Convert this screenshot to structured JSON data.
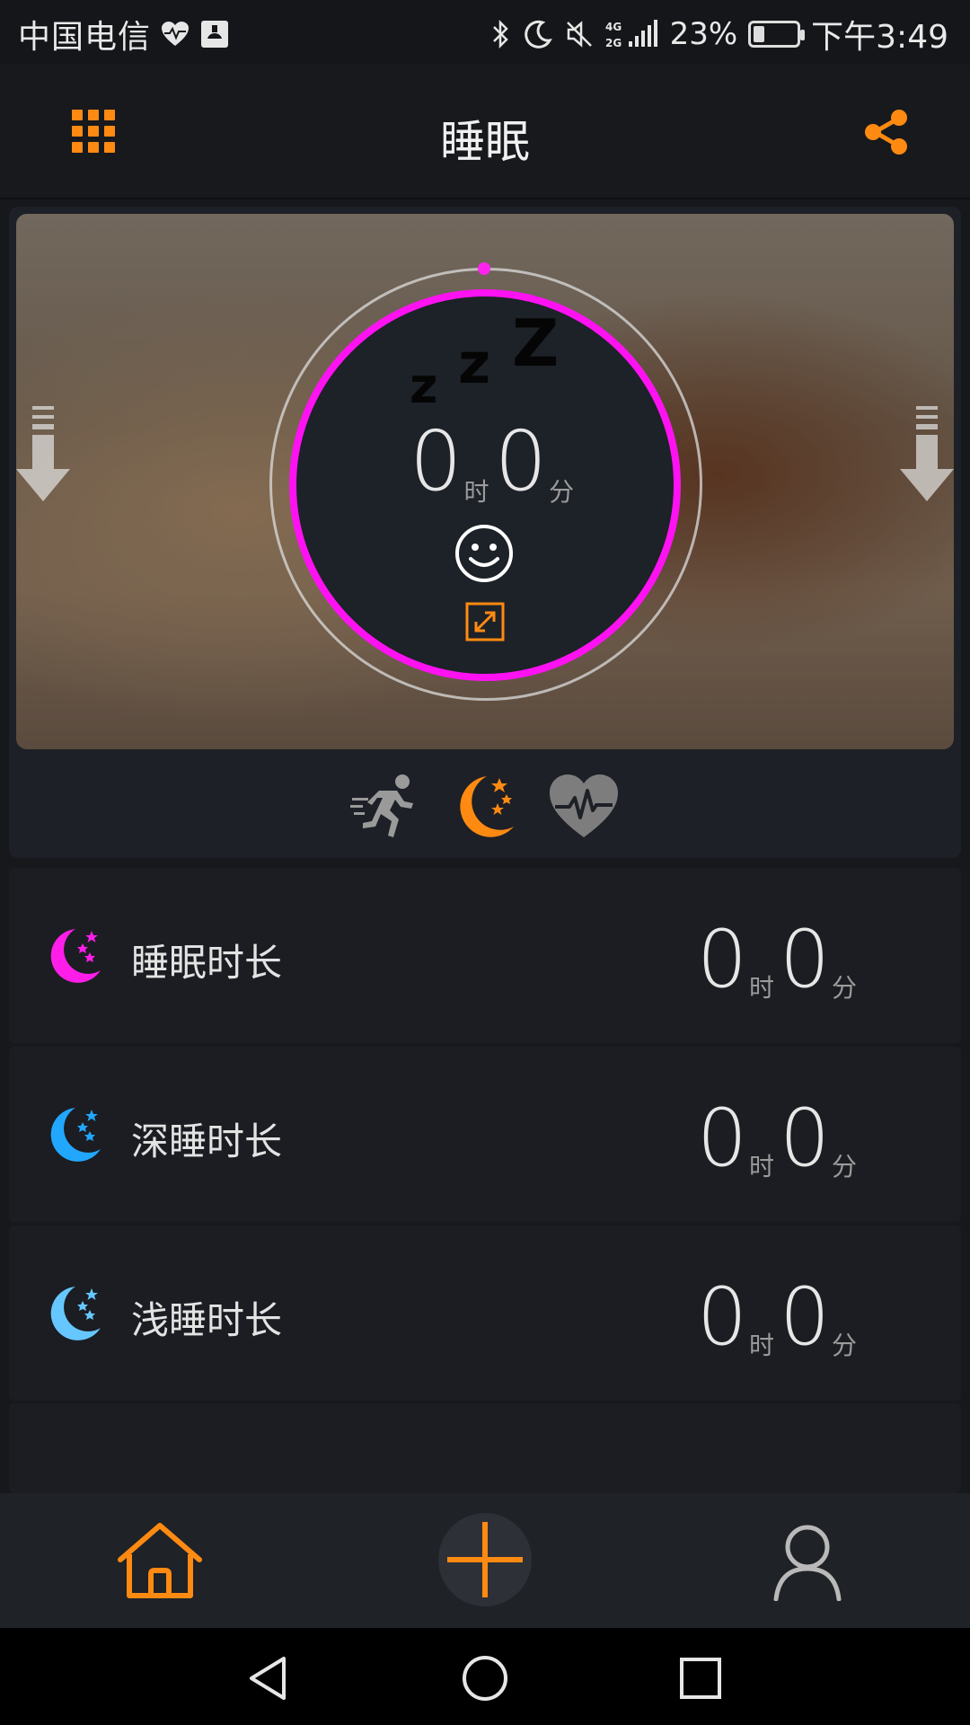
{
  "status_bar": {
    "carrier": "中国电信",
    "network": "4G 2G",
    "battery_percent": "23%",
    "time": "下午3:49"
  },
  "header": {
    "title": "睡眠",
    "menu_icon": "grid-icon",
    "share_icon": "share-icon"
  },
  "hero": {
    "zzz": [
      "z",
      "z",
      "Z"
    ],
    "hours_value": "0",
    "hours_unit": "时",
    "minutes_value": "0",
    "minutes_unit": "分",
    "ring_color": "#ff12f2",
    "modes": [
      {
        "name": "running-icon",
        "active": false
      },
      {
        "name": "moon-stars-icon",
        "active": true
      },
      {
        "name": "heart-rate-icon",
        "active": false
      }
    ],
    "accent_color": "#ff8a12"
  },
  "stats": [
    {
      "label": "睡眠时长",
      "hours": "0",
      "hours_unit": "时",
      "minutes": "0",
      "minutes_unit": "分",
      "icon_color": "#ff1ee9"
    },
    {
      "label": "深睡时长",
      "hours": "0",
      "hours_unit": "时",
      "minutes": "0",
      "minutes_unit": "分",
      "icon_color": "#22a7ff"
    },
    {
      "label": "浅睡时长",
      "hours": "0",
      "hours_unit": "时",
      "minutes": "0",
      "minutes_unit": "分",
      "icon_color": "#66c6ff"
    }
  ],
  "bottom_tabs": [
    "home-icon",
    "add-icon",
    "user-icon"
  ],
  "nav_buttons": [
    "back-icon",
    "home-circle-icon",
    "recents-icon"
  ]
}
